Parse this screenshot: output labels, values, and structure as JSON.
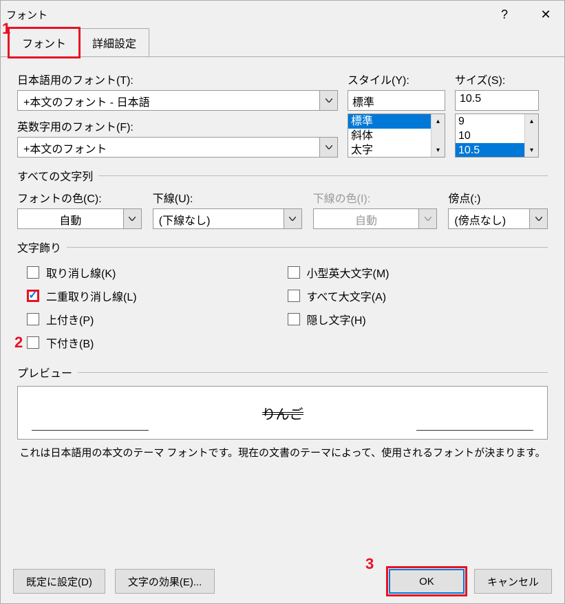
{
  "title": "フォント",
  "tabs": {
    "font": "フォント",
    "advanced": "詳細設定"
  },
  "labels": {
    "jpFont": "日本語用のフォント(T):",
    "enFont": "英数字用のフォント(F):",
    "style": "スタイル(Y):",
    "size": "サイズ(S):",
    "allChars": "すべての文字列",
    "fontColor": "フォントの色(C):",
    "underline": "下線(U):",
    "underlineColor": "下線の色(I):",
    "emphasis": "傍点(:)",
    "effects": "文字飾り",
    "preview": "プレビュー"
  },
  "values": {
    "jpFont": "+本文のフォント - 日本語",
    "enFont": "+本文のフォント",
    "style": "標準",
    "size": "10.5",
    "fontColor": "自動",
    "underline": "(下線なし)",
    "underlineColor": "自動",
    "emphasis": "(傍点なし)"
  },
  "styleList": [
    "標準",
    "斜体",
    "太字"
  ],
  "sizeList": [
    "9",
    "10",
    "10.5"
  ],
  "effectsLeft": [
    {
      "label": "取り消し線(K)",
      "checked": false
    },
    {
      "label": "二重取り消し線(L)",
      "checked": true
    },
    {
      "label": "上付き(P)",
      "checked": false
    },
    {
      "label": "下付き(B)",
      "checked": false
    }
  ],
  "effectsRight": [
    {
      "label": "小型英大文字(M)",
      "checked": false
    },
    {
      "label": "すべて大文字(A)",
      "checked": false
    },
    {
      "label": "隠し文字(H)",
      "checked": false
    }
  ],
  "previewText": "りんご",
  "previewDesc": "これは日本語用の本文のテーマ フォントです。現在の文書のテーマによって、使用されるフォントが決まります。",
  "buttons": {
    "default": "既定に設定(D)",
    "textEffects": "文字の効果(E)...",
    "ok": "OK",
    "cancel": "キャンセル"
  },
  "annotations": {
    "a1": "1",
    "a2": "2",
    "a3": "3"
  }
}
